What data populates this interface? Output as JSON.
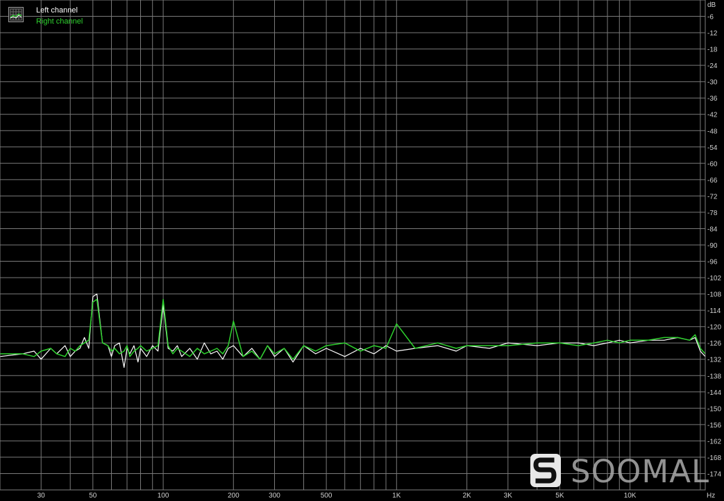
{
  "chart_data": {
    "type": "line",
    "xscale": "log",
    "xlim": [
      20,
      21000
    ],
    "ylim": [
      0,
      -180
    ],
    "xlabel": "Hz",
    "ylabel": "dB",
    "grid": true,
    "legend_position": "top-left",
    "x_tick_labels": [
      {
        "value": 30,
        "label": "30"
      },
      {
        "value": 50,
        "label": "50"
      },
      {
        "value": 100,
        "label": "100"
      },
      {
        "value": 200,
        "label": "200"
      },
      {
        "value": 300,
        "label": "300"
      },
      {
        "value": 500,
        "label": "500"
      },
      {
        "value": 1000,
        "label": "1K"
      },
      {
        "value": 2000,
        "label": "2K"
      },
      {
        "value": 3000,
        "label": "3K"
      },
      {
        "value": 5000,
        "label": "5K"
      },
      {
        "value": 10000,
        "label": "10K"
      }
    ],
    "y_ticks": [
      -6,
      -12,
      -18,
      -24,
      -30,
      -36,
      -42,
      -48,
      -54,
      -60,
      -66,
      -72,
      -78,
      -84,
      -90,
      -96,
      -102,
      -108,
      -114,
      -120,
      -126,
      -132,
      -138,
      -144,
      -150,
      -156,
      -162,
      -168,
      -174
    ],
    "series": [
      {
        "name": "Left channel",
        "color": "#ffffff",
        "x": [
          20,
          25,
          28,
          30,
          33,
          35,
          38,
          40,
          42,
          44,
          46,
          48,
          50,
          52,
          55,
          58,
          60,
          62,
          65,
          68,
          70,
          72,
          75,
          78,
          80,
          85,
          90,
          95,
          100,
          105,
          110,
          115,
          120,
          130,
          140,
          150,
          160,
          170,
          180,
          190,
          200,
          220,
          240,
          260,
          280,
          300,
          330,
          360,
          400,
          450,
          500,
          600,
          700,
          800,
          900,
          1000,
          1200,
          1500,
          1800,
          2000,
          2500,
          3000,
          4000,
          5000,
          6000,
          7000,
          8000,
          9000,
          10000,
          12000,
          14000,
          16000,
          18000,
          19000,
          20000,
          21000
        ],
        "y": [
          -131,
          -130,
          -129,
          -132,
          -128,
          -130,
          -127,
          -131,
          -129,
          -128,
          -124,
          -128,
          -109,
          -108,
          -126,
          -127,
          -131,
          -127,
          -126,
          -135,
          -128,
          -130,
          -127,
          -133,
          -128,
          -131,
          -127,
          -129,
          -112,
          -128,
          -129,
          -127,
          -131,
          -128,
          -132,
          -126,
          -130,
          -129,
          -132,
          -128,
          -127,
          -131,
          -128,
          -132,
          -127,
          -131,
          -128,
          -133,
          -127,
          -130,
          -128,
          -131,
          -128,
          -130,
          -127,
          -129,
          -128,
          -127,
          -129,
          -127,
          -128,
          -126,
          -127,
          -126,
          -126,
          -127,
          -126,
          -125,
          -126,
          -125,
          -125,
          -124,
          -125,
          -124,
          -129,
          -131
        ]
      },
      {
        "name": "Right channel",
        "color": "#2ed12e",
        "x": [
          20,
          25,
          28,
          30,
          33,
          35,
          38,
          40,
          42,
          44,
          46,
          48,
          50,
          52,
          55,
          58,
          60,
          62,
          65,
          68,
          70,
          72,
          75,
          78,
          80,
          85,
          90,
          95,
          100,
          105,
          110,
          115,
          120,
          130,
          140,
          150,
          160,
          170,
          180,
          190,
          200,
          220,
          240,
          260,
          280,
          300,
          330,
          360,
          400,
          450,
          500,
          600,
          700,
          800,
          900,
          1000,
          1200,
          1500,
          1800,
          2000,
          2500,
          3000,
          4000,
          5000,
          6000,
          7000,
          8000,
          9000,
          10000,
          12000,
          14000,
          16000,
          18000,
          19000,
          20000,
          21000
        ],
        "y": [
          -130,
          -130,
          -131,
          -129,
          -128,
          -130,
          -131,
          -128,
          -129,
          -127,
          -126,
          -125,
          -111,
          -110,
          -126,
          -127,
          -129,
          -128,
          -130,
          -129,
          -127,
          -131,
          -129,
          -128,
          -127,
          -129,
          -128,
          -127,
          -110,
          -127,
          -130,
          -128,
          -129,
          -131,
          -128,
          -130,
          -129,
          -128,
          -130,
          -127,
          -118,
          -131,
          -129,
          -132,
          -127,
          -130,
          -128,
          -132,
          -127,
          -129,
          -127,
          -126,
          -129,
          -127,
          -128,
          -119,
          -128,
          -126,
          -128,
          -127,
          -127,
          -127,
          -126,
          -126,
          -127,
          -126,
          -125,
          -126,
          -125,
          -125,
          -124,
          -124,
          -125,
          -123,
          -128,
          -130
        ]
      }
    ]
  },
  "watermark": {
    "text": "SOOMAL"
  }
}
